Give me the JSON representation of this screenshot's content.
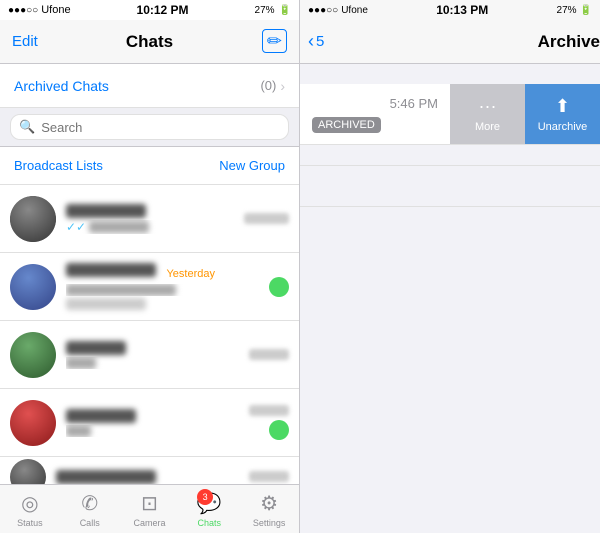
{
  "left": {
    "status_bar": {
      "carrier": "Ufone",
      "time": "10:12 PM",
      "battery": "27%"
    },
    "nav": {
      "edit_label": "Edit",
      "title": "Chats",
      "compose_icon": "✏"
    },
    "archived_row": {
      "label": "Archived Chats",
      "count": "(0)",
      "chevron": "›"
    },
    "search": {
      "placeholder": "Search"
    },
    "broadcast": {
      "broadcast_label": "Broadcast Lists",
      "new_group_label": "New Group"
    },
    "chats": [
      {
        "name": "Younus",
        "preview": "🗸🗸 photo",
        "time": "5:46 PM",
        "unread": false,
        "avatar_style": "dark"
      },
      {
        "name": "What does la...",
        "preview": "Maryam Nawabzee",
        "time": "Yesterday",
        "unread": true,
        "unread_count": "",
        "avatar_style": "blue"
      },
      {
        "name": "Niwa",
        "preview": "hi",
        "time": "6/7/17",
        "unread": false,
        "avatar_style": "green"
      },
      {
        "name": "Mommy",
        "preview": "ok",
        "time": "6/7/17",
        "unread": true,
        "unread_count": "",
        "avatar_style": "red"
      },
      {
        "name": "Wiiiiiiuuiuuui",
        "preview": "",
        "time": "6/7/17",
        "unread": false,
        "avatar_style": "dark"
      }
    ],
    "tab_bar": {
      "items": [
        {
          "icon": "⊙",
          "label": "Status",
          "active": false
        },
        {
          "icon": "✆",
          "label": "Calls",
          "active": false
        },
        {
          "icon": "⊡",
          "label": "Camera",
          "active": false
        },
        {
          "icon": "💬",
          "label": "Chats",
          "active": true,
          "badge": "3"
        },
        {
          "icon": "⚙",
          "label": "Settings",
          "active": false
        }
      ]
    }
  },
  "right": {
    "status_bar": {
      "carrier": "Ufone",
      "time": "10:13 PM",
      "battery": "27%"
    },
    "nav": {
      "back_label": "5",
      "title": "Archived Chats"
    },
    "swipe_row": {
      "time": "5:46 PM",
      "archived_badge": "ARCHIVED",
      "more_label": "More",
      "more_icon": "···",
      "unarchive_label": "Unarchive",
      "unarchive_icon": "⬆"
    }
  }
}
